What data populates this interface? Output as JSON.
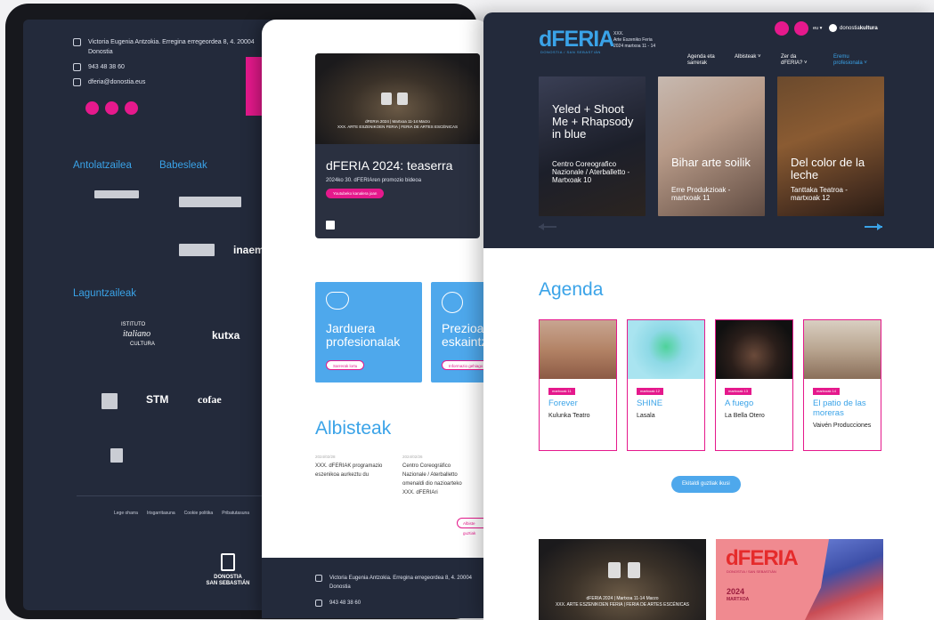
{
  "tablet": {
    "contact": {
      "address": "Victoria Eugenia Antzokia. Erregina erregeordea 8, 4. 20004 Donostia",
      "phone": "943 48 38 60",
      "email": "dferia@donostia.eus"
    },
    "headings": {
      "organizer": "Antolatzailea",
      "sponsors": "Babesleak",
      "collaborators": "Laguntzaileak"
    },
    "logos": {
      "inaem": "inaem",
      "italiano": "italiano",
      "istituto": "ISTITUTO",
      "cultura": "CULTURA",
      "kutxa": "kutxa",
      "stm": "STM",
      "cofae": "cofae"
    },
    "footer_links": [
      "Lege oharra",
      "Irisgarritasuna",
      "Cookie politika",
      "Pribatutasuna"
    ],
    "city": {
      "line1": "DONOSTIA",
      "line2": "SAN SEBASTIÁN"
    }
  },
  "phone": {
    "video": {
      "caption_line1": "dFERIA 2024 | Martxoa 11-14 Marzo",
      "caption_line2": "XXX. ARTE ESZENIKOEN FERIA | FERIA DE ARTES ESCÉNICAS",
      "title": "dFERIA 2024: teaserra",
      "subtitle": "2024ko 30. dFERIAren promozio bideoa",
      "button": "Youtubeko kanalera joan"
    },
    "cards": [
      {
        "title": "Jarduera profesionalak",
        "button": "Sarrerak lortu"
      },
      {
        "title": "Prezioak eta eskaintzak",
        "button": "Informazio gehiago"
      }
    ],
    "news_heading": "Albisteak",
    "news": [
      {
        "date": "2024/02/28",
        "text": "XXX. dFERIAK programazio eszenikoa aurkeztu du"
      },
      {
        "date": "2024/02/26",
        "text": "Centro Coreográfico Nazionale / Aterballetto omenaldi dio nazioarteko XXX. dFERIAri"
      }
    ],
    "more_news": "Albiste guztiak",
    "footer": {
      "address": "Victoria Eugenia Antzokia. Erregina erregeordea 8, 4. 20004 Donostia",
      "phone": "943 48 38 60"
    }
  },
  "desktop": {
    "logo": "dFERIA",
    "logo_sub": "DONOSTIA / SAN SEBASTIÁN",
    "edition": {
      "line1": "XXX.",
      "line2": "Arte Eszeniko Feria",
      "line3": "2024 martxoa 11 - 14"
    },
    "lang": "eu ▾",
    "brand": {
      "regular": "donostia",
      "bold": "kultura"
    },
    "nav": [
      {
        "label": "Agenda eta sarrerak"
      },
      {
        "label": "Albisteak ˅"
      },
      {
        "label": "Zer da dFERIA? ˅"
      },
      {
        "label": "Eremu profesionala ˅"
      }
    ],
    "shows": [
      {
        "title": "Yeled + Shoot Me + Rhapsody in blue",
        "subtitle": "Centro Coreografico Nazionale / Aterballetto - Martxoak 10"
      },
      {
        "title": "Bihar arte soilik",
        "subtitle": "Erre Produkzioak - martxoak 11"
      },
      {
        "title": "Del color de la leche",
        "subtitle": "Tanttaka Teatroa - martxoak 12"
      }
    ],
    "agenda_heading": "Agenda",
    "agenda": [
      {
        "date": "martxoak 11",
        "title": "Forever",
        "company": "Kulunka Teatro"
      },
      {
        "date": "martxoak 12",
        "title": "SHINE",
        "company": "Lasala"
      },
      {
        "date": "martxoak 13",
        "title": "A fuego",
        "company": "La Bella Otero"
      },
      {
        "date": "martxoak 14",
        "title": "El patio de las moreras",
        "company": "Vaivén Producciones"
      }
    ],
    "all_button": "Ekitaldi guztiak ikusi",
    "bottom": {
      "caption_line1": "dFERIA 2024 | Martxoa 11-14 Marzo",
      "caption_line2": "XXX. ARTE ESZENIKOEN FERIA | FERIA DE ARTES ESCÉNICAS",
      "poster_logo": "dFERIA",
      "poster_sub": "DONOSTIA / SAN SEBASTIÁN",
      "poster_year": "2024",
      "poster_line": "MARTXOA"
    }
  },
  "colors": {
    "navy": "#232a3b",
    "accent_blue": "#3aa3e8",
    "magenta": "#e5198c",
    "card_blue": "#4ea8ec"
  }
}
